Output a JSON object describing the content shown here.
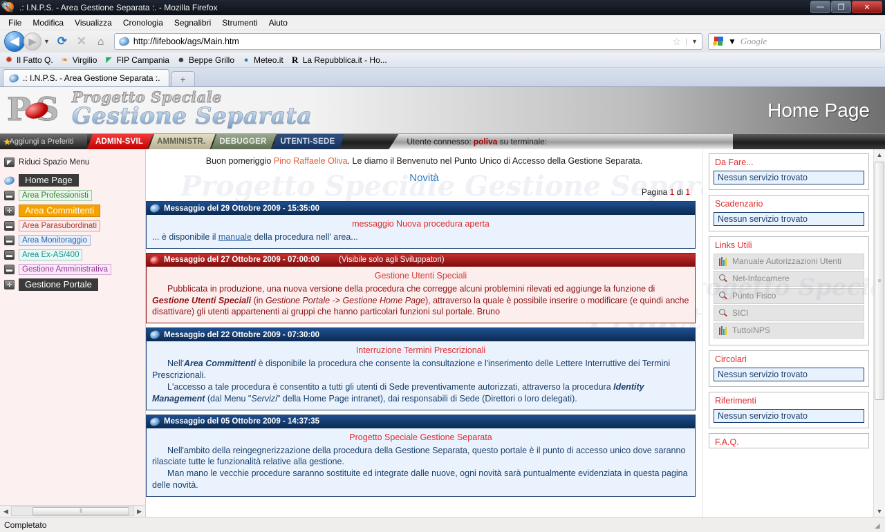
{
  "window": {
    "title": ".: I.N.P.S. - Area Gestione Separata :. - Mozilla Firefox",
    "minimize": "—",
    "maximize": "❐",
    "close": "✕"
  },
  "menubar": [
    "File",
    "Modifica",
    "Visualizza",
    "Cronologia",
    "Segnalibri",
    "Strumenti",
    "Aiuto"
  ],
  "navbar": {
    "back": "◀",
    "forward": "▶",
    "dropdown": "▼",
    "reload": "⟳",
    "stop": "✕",
    "home": "⌂",
    "url": "http://lifebook/ags/Main.htm",
    "star": "☆",
    "url_caret": "▼",
    "search_placeholder": "Google",
    "search_value": "",
    "search_caret": "▼",
    "search_icon": "🔍"
  },
  "bookmarks": [
    {
      "label": "Il Fatto Q.",
      "icon": "fatto-quotidiano-icon"
    },
    {
      "label": "Virgilio",
      "icon": "virgilio-icon"
    },
    {
      "label": "FIP Campania",
      "icon": "fip-campania-icon"
    },
    {
      "label": "Beppe Grillo",
      "icon": "beppe-grillo-icon"
    },
    {
      "label": "Meteo.it",
      "icon": "meteo-icon"
    },
    {
      "label": "La Repubblica.it - Ho...",
      "icon": "repubblica-icon"
    }
  ],
  "tabs": {
    "active": ".: I.N.P.S. - Area Gestione Separata :.",
    "newtab": "+"
  },
  "banner": {
    "logo_p": "P",
    "logo_s": "S",
    "line1": "Progetto Speciale",
    "line2": "Gestione Separata",
    "page_title": "Home Page"
  },
  "rolebar": {
    "preferiti": "Aggiungi a Preferiti",
    "tabs": [
      {
        "label": "ADMIN-SVIL",
        "style": "admin"
      },
      {
        "label": "AMMINISTR.",
        "style": "amm"
      },
      {
        "label": "DEBUGGER",
        "style": "dbg"
      },
      {
        "label": "UTENTI-SEDE",
        "style": "usede"
      }
    ],
    "user_prefix": "Utente connesso:",
    "user_name": "poliva",
    "user_suffix": "su terminale:"
  },
  "leftmenu": {
    "reduce": "Riduci Spazio Menu",
    "items": [
      {
        "label": "Home Page",
        "style": "home",
        "icon": "globe-icon"
      },
      {
        "label": "Area Professionisti",
        "style": "prof",
        "icon": "folder-icon"
      },
      {
        "label": "Area Committenti",
        "style": "comm",
        "icon": "expand-icon"
      },
      {
        "label": "Area Parasubordinati",
        "style": "para",
        "icon": "folder-icon"
      },
      {
        "label": "Area Monitoraggio",
        "style": "moni",
        "icon": "folder-icon"
      },
      {
        "label": "Area Ex-AS/400",
        "style": "exas",
        "icon": "folder-icon"
      },
      {
        "label": "Gestione Amministrativa",
        "style": "gamm",
        "icon": "folder-icon"
      },
      {
        "label": "Gestione Portale",
        "style": "gpor",
        "icon": "expand-icon"
      }
    ],
    "hscroll": {
      "left": "◀",
      "right": "▶",
      "grip": "⦀"
    }
  },
  "main": {
    "watermark": "Progetto Speciale Gestione Separata",
    "greeting_prefix": "Buon pomeriggio",
    "greeting_name": "Pino Raffaele Oliva",
    "greeting_suffix": ". Le diamo il Benvenuto nel Punto Unico di Accesso della Gestione Separata.",
    "novita": "Novità",
    "pagina_prefix": "Pagina",
    "pagina_current": "1",
    "pagina_of": "di",
    "pagina_total": "1",
    "messages": [
      {
        "header": "Messaggio del 29 Ottobre 2009 - 15:35:00",
        "devnote": "",
        "style": "blue",
        "title": "messaggio Nuova procedura aperta",
        "body_pre": "... è disponibile il ",
        "body_link": "manuale",
        "body_post": " della procedura nell' area..."
      },
      {
        "header": "Messaggio del 27 Ottobre 2009 - 07:00:00",
        "devnote": "(Visibile solo agli Sviluppatori)",
        "style": "red",
        "title": "Gestione Utenti Speciali",
        "p1_a": "Pubblicata in produzione, una nuova versione della procedura che corregge alcuni problemini rilevati ed aggiunge la funzione di ",
        "p1_b": "Gestione Utenti Speciali",
        "p1_c": " (in ",
        "p1_d": "Gestione Portale -> Gestione Home Page",
        "p1_e": "), attraverso la quale è possibile inserire o modificare (e quindi anche disattivare) gli utenti appartenenti ai gruppi che hanno particolari funzioni sul portale. Bruno"
      },
      {
        "header": "Messaggio del 22 Ottobre 2009 - 07:30:00",
        "devnote": "",
        "style": "blue",
        "title": "Interruzione Termini Prescrizionali",
        "p1_a": "Nell'",
        "p1_b": "Area Committenti",
        "p1_c": " è disponibile la procedura che consente la consultazione e l'inserimento delle Lettere Interruttive dei Termini Prescrizionali.",
        "p2_a": "L'accesso a tale procedura è consentito a tutti gli utenti di Sede preventivamente autorizzati, attraverso la procedura ",
        "p2_b": "Identity Management",
        "p2_c": " (dal Menu \"",
        "p2_d": "Servizi",
        "p2_e": "\" della Home Page intranet), dai responsabili di Sede (Direttori o loro delegati)."
      },
      {
        "header": "Messaggio del 05 Ottobre 2009 - 14:37:35",
        "devnote": "",
        "style": "blue",
        "title": "Progetto Speciale Gestione Separata",
        "p1": "Nell'ambito della reingegnerizzazione della procedura della Gestione Separata, questo portale è il punto di accesso unico dove saranno rilasciate tutte le funzionalità relative alla gestione.",
        "p2": "Man mano le vecchie procedure saranno sostituite ed integrate dalle nuove, ogni novità sarà puntualmente evidenziata in questa pagina delle novità."
      }
    ]
  },
  "rightpanels": [
    {
      "title": "Da Fare...",
      "empty": "Nessun servizio trovato",
      "type": "empty"
    },
    {
      "title": "Scadenzario",
      "empty": "Nessun servizio trovato",
      "type": "empty"
    },
    {
      "title": "Links Utili",
      "type": "links",
      "links": [
        {
          "label": "Manuale Autorizzazioni Utenti",
          "icon": "books-icon"
        },
        {
          "label": "Net-Infocamere",
          "icon": "magnifier-icon"
        },
        {
          "label": "Punto Fisco",
          "icon": "magnifier-icon"
        },
        {
          "label": "SICI",
          "icon": "magnifier-icon"
        },
        {
          "label": "TuttoINPS",
          "icon": "books-icon"
        }
      ]
    },
    {
      "title": "Circolari",
      "empty": "Nessun servizio trovato",
      "type": "empty"
    },
    {
      "title": "Riferimenti",
      "empty": "Nessun servizio trovato",
      "type": "empty"
    },
    {
      "title": "F.A.Q.",
      "type": "peek"
    }
  ],
  "vscroll": {
    "up": "▲",
    "down": "▼",
    "grip": "≡"
  },
  "statusbar": {
    "text": "Completato",
    "grip": "◢"
  },
  "colors": {
    "accent_red": "#e02b2b",
    "accent_blue": "#2b7ac4",
    "header_blue": "#1f4f8f",
    "header_red": "#c43131",
    "orange_highlight": "#f5a200"
  }
}
